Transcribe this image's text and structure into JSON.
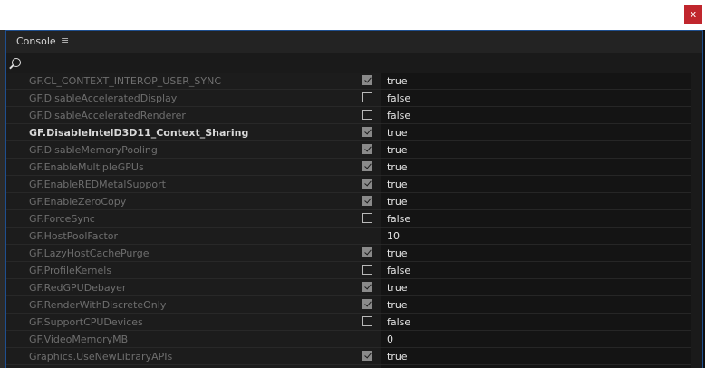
{
  "window": {
    "close_label": "x"
  },
  "panel": {
    "title": "Console",
    "menu_glyph": "≡"
  },
  "search": {
    "value": "",
    "placeholder": ""
  },
  "rows": [
    {
      "name": "GF.CL_CONTEXT_INTEROP_USER_SYNC",
      "checked": true,
      "value": "true",
      "has_checkbox": true,
      "bold": false
    },
    {
      "name": "GF.DisableAcceleratedDisplay",
      "checked": false,
      "value": "false",
      "has_checkbox": true,
      "bold": false
    },
    {
      "name": "GF.DisableAcceleratedRenderer",
      "checked": false,
      "value": "false",
      "has_checkbox": true,
      "bold": false
    },
    {
      "name": "GF.DisableIntelD3D11_Context_Sharing",
      "checked": true,
      "value": "true",
      "has_checkbox": true,
      "bold": true
    },
    {
      "name": "GF.DisableMemoryPooling",
      "checked": true,
      "value": "true",
      "has_checkbox": true,
      "bold": false
    },
    {
      "name": "GF.EnableMultipleGPUs",
      "checked": true,
      "value": "true",
      "has_checkbox": true,
      "bold": false
    },
    {
      "name": "GF.EnableREDMetalSupport",
      "checked": true,
      "value": "true",
      "has_checkbox": true,
      "bold": false
    },
    {
      "name": "GF.EnableZeroCopy",
      "checked": true,
      "value": "true",
      "has_checkbox": true,
      "bold": false
    },
    {
      "name": "GF.ForceSync",
      "checked": false,
      "value": "false",
      "has_checkbox": true,
      "bold": false
    },
    {
      "name": "GF.HostPoolFactor",
      "checked": false,
      "value": "10",
      "has_checkbox": false,
      "bold": false
    },
    {
      "name": "GF.LazyHostCachePurge",
      "checked": true,
      "value": "true",
      "has_checkbox": true,
      "bold": false
    },
    {
      "name": "GF.ProfileKernels",
      "checked": false,
      "value": "false",
      "has_checkbox": true,
      "bold": false
    },
    {
      "name": "GF.RedGPUDebayer",
      "checked": true,
      "value": "true",
      "has_checkbox": true,
      "bold": false
    },
    {
      "name": "GF.RenderWithDiscreteOnly",
      "checked": true,
      "value": "true",
      "has_checkbox": true,
      "bold": false
    },
    {
      "name": "GF.SupportCPUDevices",
      "checked": false,
      "value": "false",
      "has_checkbox": true,
      "bold": false
    },
    {
      "name": "GF.VideoMemoryMB",
      "checked": false,
      "value": "0",
      "has_checkbox": false,
      "bold": false
    },
    {
      "name": "Graphics.UseNewLibraryAPIs",
      "checked": true,
      "value": "true",
      "has_checkbox": true,
      "bold": false
    },
    {
      "name": "",
      "checked": true,
      "value": "",
      "has_checkbox": true,
      "bold": false
    }
  ]
}
